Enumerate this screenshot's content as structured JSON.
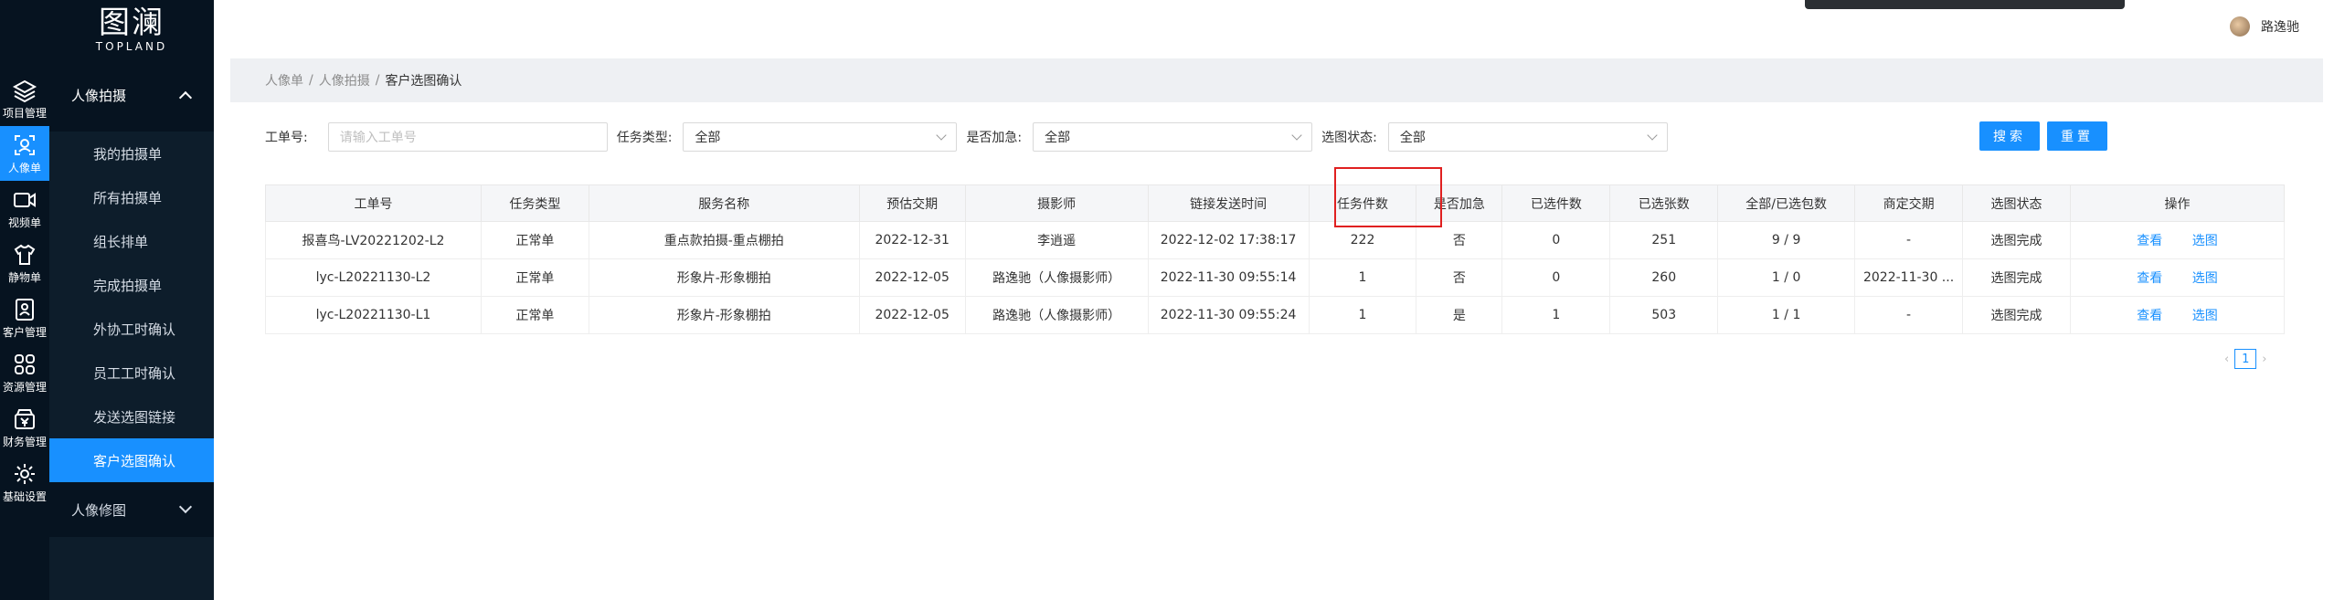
{
  "brand": {
    "mark": "图澜",
    "word": "TOPLAND"
  },
  "rail": [
    {
      "label": "项目管理",
      "icon": "layers-icon"
    },
    {
      "label": "人像单",
      "icon": "portrait-icon"
    },
    {
      "label": "视频单",
      "icon": "video-icon"
    },
    {
      "label": "静物单",
      "icon": "shirt-icon"
    },
    {
      "label": "客户管理",
      "icon": "customer-icon"
    },
    {
      "label": "资源管理",
      "icon": "grid-icon"
    },
    {
      "label": "财务管理",
      "icon": "finance-icon"
    },
    {
      "label": "基础设置",
      "icon": "gear-icon"
    }
  ],
  "menu": {
    "group": "人像拍摄",
    "items": [
      "我的拍摄单",
      "所有拍摄单",
      "组长排单",
      "完成拍摄单",
      "外协工时确认",
      "员工工时确认",
      "发送选图链接",
      "客户选图确认"
    ],
    "active_index": 7,
    "footer": "人像修图"
  },
  "header": {
    "user_name": "路逸驰",
    "accent": "#1890ff"
  },
  "breadcrumb": {
    "items": [
      "人像单",
      "人像拍摄"
    ],
    "current": "客户选图确认",
    "separator": "/"
  },
  "filters": {
    "order_label": "工单号:",
    "order_placeholder": "请输入工单号",
    "type_label": "任务类型:",
    "type_value": "全部",
    "urgent_label": "是否加急:",
    "urgent_value": "全部",
    "select_label": "选图状态:",
    "select_value": "全部",
    "search_label": "搜索",
    "reset_label": "重置"
  },
  "table": {
    "columns": [
      "工单号",
      "任务类型",
      "服务名称",
      "预估交期",
      "摄影师",
      "链接发送时间",
      "任务件数",
      "是否加急",
      "已选件数",
      "已选张数",
      "全部/已选包数",
      "商定交期",
      "选图状态",
      "操作"
    ],
    "rows": [
      [
        "报喜鸟-LV20221202-L2",
        "正常单",
        "重点款拍摄-重点棚拍",
        "2022-12-31",
        "李逍遥",
        "2022-12-02 17:38:17",
        "222",
        "否",
        "0",
        "251",
        "9 / 9",
        "-",
        "选图完成"
      ],
      [
        "lyc-L20221130-L2",
        "正常单",
        "形象片-形象棚拍",
        "2022-12-05",
        "路逸驰（人像摄影师）",
        "2022-11-30 09:55:14",
        "1",
        "否",
        "0",
        "260",
        "1 / 0",
        "2022-11-30 ...",
        "选图完成"
      ],
      [
        "lyc-L20221130-L1",
        "正常单",
        "形象片-形象棚拍",
        "2022-12-05",
        "路逸驰（人像摄影师）",
        "2022-11-30 09:55:24",
        "1",
        "是",
        "1",
        "503",
        "1 / 1",
        "-",
        "选图完成"
      ]
    ],
    "actions": [
      "查看",
      "选图"
    ]
  },
  "pagination": {
    "current": "1",
    "prev": "‹",
    "next": "›"
  }
}
